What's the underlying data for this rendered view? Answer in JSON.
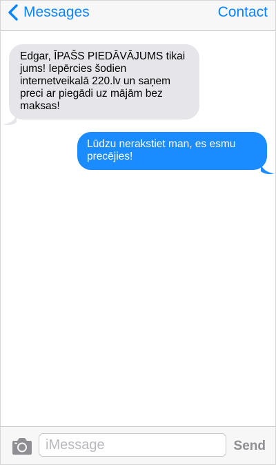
{
  "navbar": {
    "back_label": "Messages",
    "contact_label": "Contact",
    "accent_color": "#0a84ff"
  },
  "messages": [
    {
      "direction": "incoming",
      "text": "Edgar, ĪPAŠS PIEDĀVĀJUMS tikai jums! Iepērcies šodien internetveikalā 220.lv un saņem preci ar piegādi uz mājām bez maksas!",
      "bubble_color": "#e5e5ea"
    },
    {
      "direction": "outgoing",
      "text": "Lūdzu nerakstiet man, es esmu precējies!",
      "bubble_color": "#1a8cff"
    }
  ],
  "composer": {
    "camera_icon": "camera-icon",
    "placeholder": "iMessage",
    "value": "",
    "send_label": "Send"
  },
  "icons": {
    "back": "chevron-left-icon",
    "camera": "camera-icon"
  }
}
